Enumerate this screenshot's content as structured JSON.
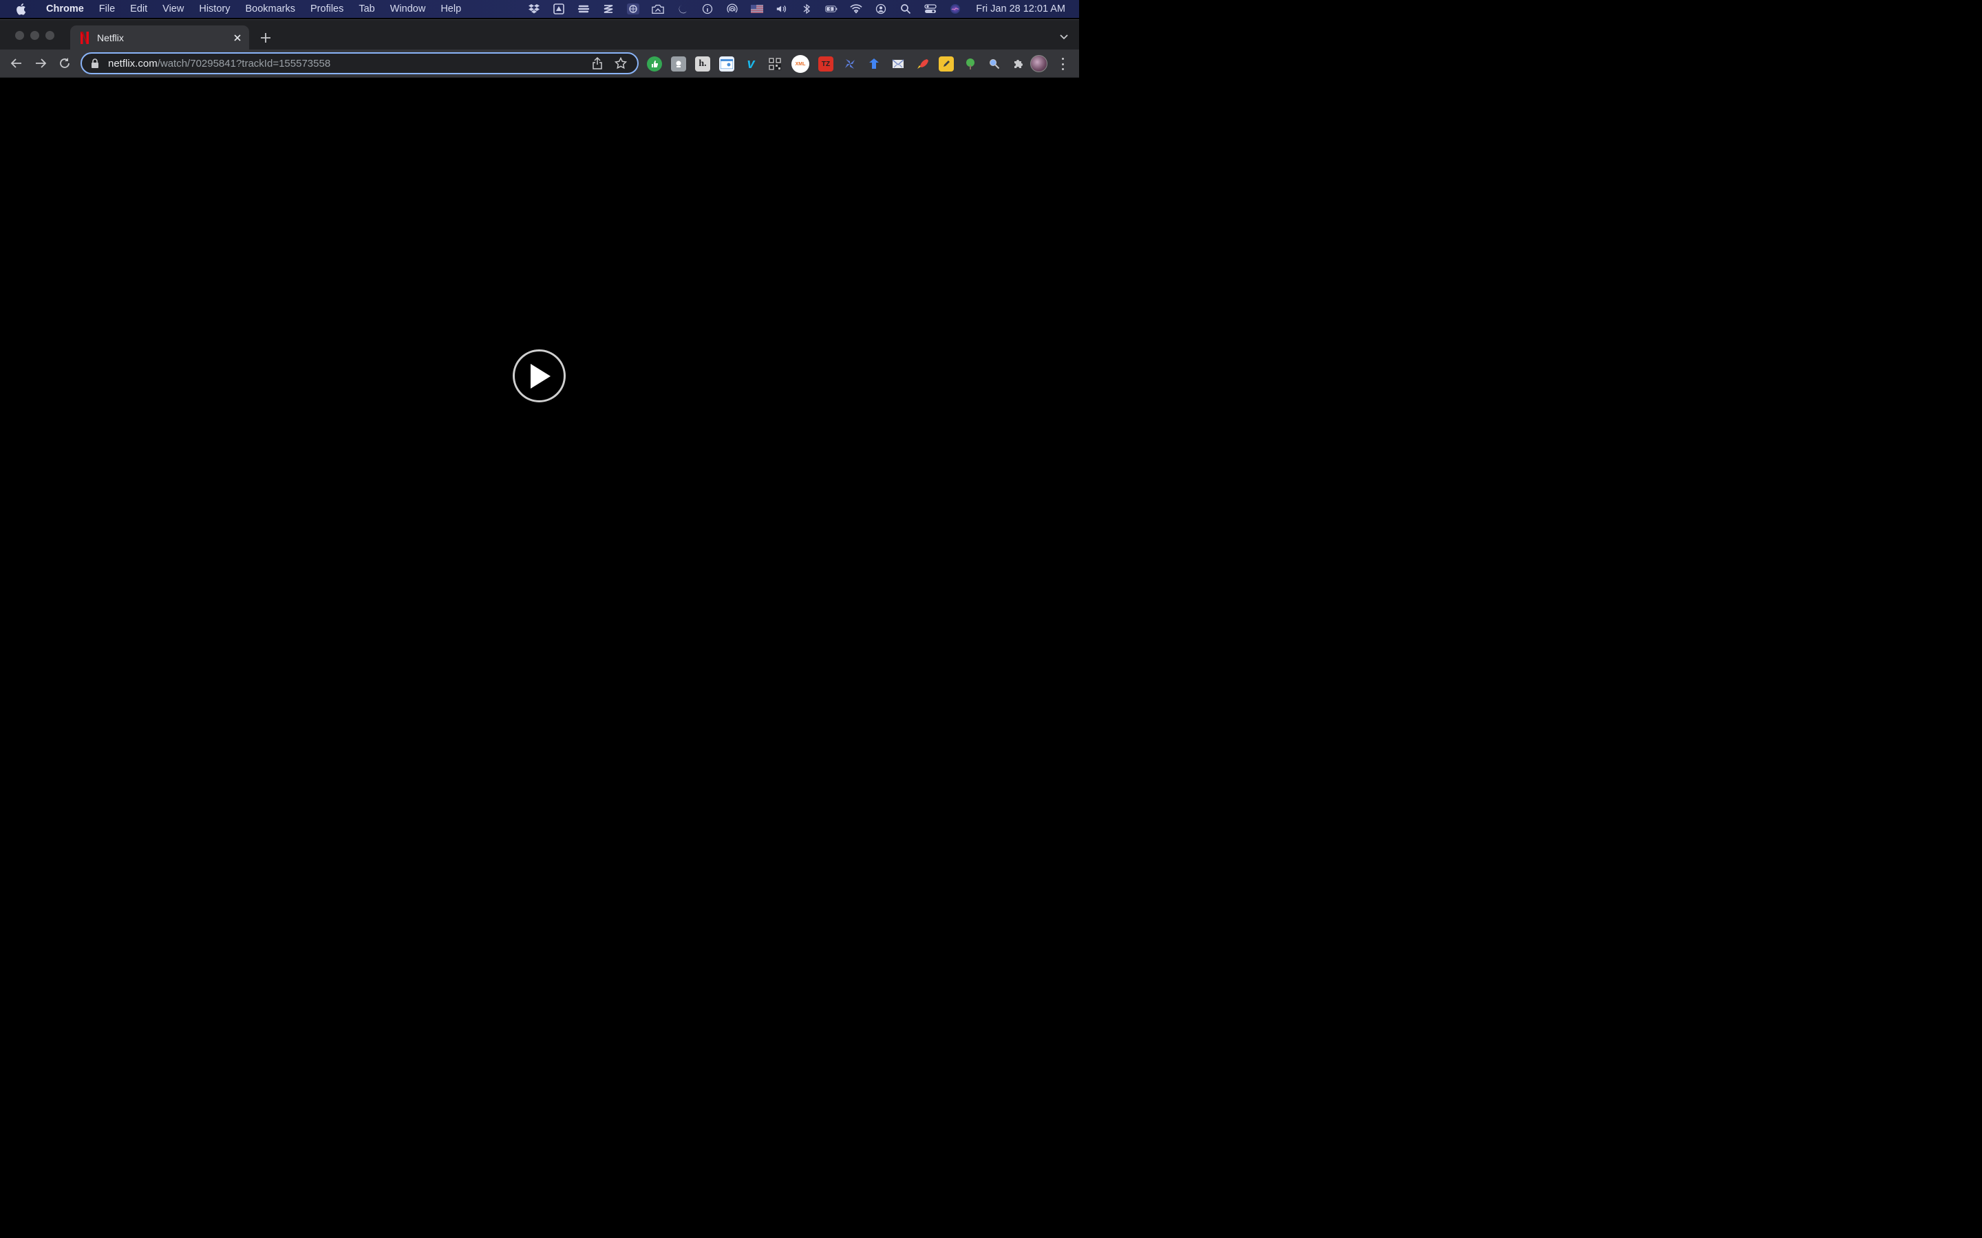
{
  "menubar": {
    "app_name": "Chrome",
    "menus": [
      "File",
      "Edit",
      "View",
      "History",
      "Bookmarks",
      "Profiles",
      "Tab",
      "Window",
      "Help"
    ],
    "status_icons": [
      "dropbox-icon",
      "google-drive-icon",
      "layers-icon",
      "stack-icon",
      "vpn-icon",
      "screenshot-icon",
      "moon-icon",
      "info-icon",
      "airdrop-icon",
      "flag-icon",
      "volume-icon",
      "bluetooth-icon",
      "battery-icon",
      "wifi-icon",
      "user-icon",
      "search-icon",
      "control-center-icon",
      "siri-icon"
    ],
    "clock": "Fri Jan 28  12:01 AM"
  },
  "browser": {
    "tab": {
      "title": "Netflix",
      "favicon": "netflix-icon"
    },
    "omnibox": {
      "host": "netflix.com",
      "path": "/watch/70295841?trackId=155573558"
    },
    "extensions": [
      {
        "name": "green-thumb-extension-icon",
        "color": "#34a853",
        "label": ""
      },
      {
        "name": "grey-square-extension-icon",
        "color": "#9aa0a6",
        "label": ""
      },
      {
        "name": "h-extension-icon",
        "color": "#5f6368",
        "label": "h."
      },
      {
        "name": "card-extension-icon",
        "color": "#4a90d9",
        "label": ""
      },
      {
        "name": "vimeo-extension-icon",
        "color": "#1ab7ea",
        "label": "v"
      },
      {
        "name": "qr-code-extension-icon",
        "color": "#3c3c3c",
        "label": ""
      },
      {
        "name": "xml-extension-icon",
        "color": "#ffffff",
        "label": "XML"
      },
      {
        "name": "red-box-extension-icon",
        "color": "#d93025",
        "label": ""
      },
      {
        "name": "pinwheel-extension-icon",
        "color": "#5b7bd5",
        "label": ""
      },
      {
        "name": "blue-arrow-extension-icon",
        "color": "#4285f4",
        "label": ""
      },
      {
        "name": "envelope-extension-icon",
        "color": "#7b8fc9",
        "label": ""
      },
      {
        "name": "red-rocket-extension-icon",
        "color": "#e8453c",
        "label": ""
      },
      {
        "name": "yellow-pen-extension-icon",
        "color": "#f2c230",
        "label": ""
      },
      {
        "name": "tree-extension-icon",
        "color": "#4caf50",
        "label": ""
      },
      {
        "name": "magnifier-extension-icon",
        "color": "#8ab4f8",
        "label": ""
      },
      {
        "name": "puzzle-extension-icon",
        "color": "#c8c9cc",
        "label": ""
      }
    ]
  },
  "colors": {
    "menubar": "#1e2552",
    "toolbar": "#35363a",
    "omnibox_focus": "#8ab4f8",
    "netflix_red": "#e50914"
  }
}
